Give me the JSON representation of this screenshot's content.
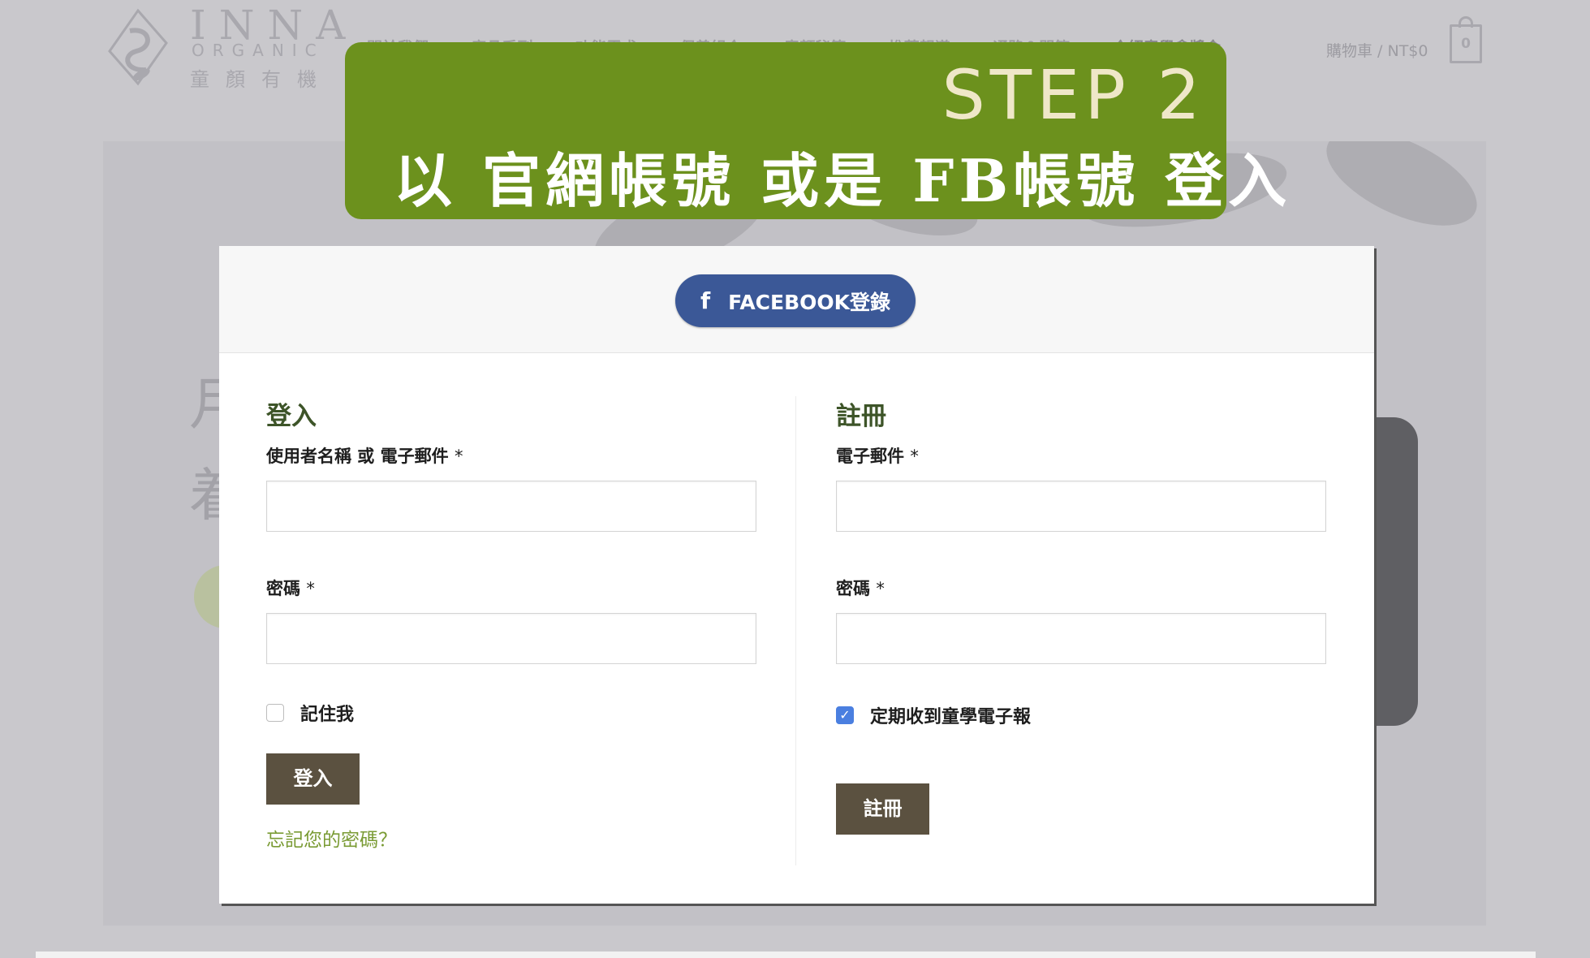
{
  "header": {
    "logo": {
      "name_en": "INNA",
      "sub_en": "ORGANIC",
      "name_cn": "童顏有機"
    },
    "nav": [
      "關於我們 ⌄",
      "產品系列 ⌄",
      "功能需求 ⌄",
      "保養組合 ⌄",
      "童顏秘笈 ⌄",
      "推薦報導 ⌄",
      "通路＆問答 ⌄",
      "介紹童學拿獎金"
    ],
    "cart_text": "購物車 / NT$0",
    "cart_count": "0"
  },
  "hero": {
    "char1": "月",
    "char2": "着"
  },
  "banner": {
    "step": "STEP 2",
    "text": "以 官網帳號 或是 FB帳號 登入"
  },
  "modal": {
    "facebook_button": {
      "icon": "f",
      "label": "FACEBOOK登錄"
    },
    "login": {
      "title": "登入",
      "username_label": "使用者名稱 或 電子郵件",
      "password_label": "密碼",
      "required_mark": "*",
      "remember_label": "記住我",
      "remember_checked": false,
      "submit_label": "登入",
      "lost_password": "忘記您的密碼？"
    },
    "register": {
      "title": "註冊",
      "email_label": "電子郵件",
      "password_label": "密碼",
      "required_mark": "*",
      "newsletter_label": "定期收到童學電子報",
      "newsletter_checked": true,
      "checkmark": "✓",
      "submit_label": "註冊"
    }
  },
  "colors": {
    "banner_bg": "#6c911d",
    "facebook_blue": "#3b5897",
    "button_brown": "#5b5140",
    "heading_green": "#3d5428",
    "link_green": "#7a9b34",
    "checkbox_blue": "#4a7fe0"
  }
}
